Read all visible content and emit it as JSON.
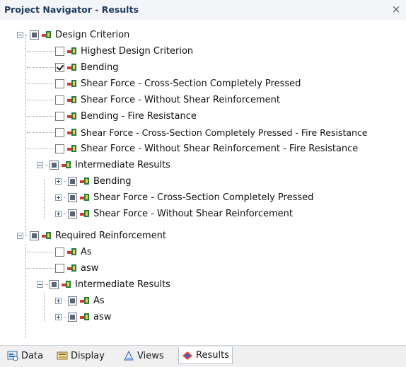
{
  "window": {
    "title": "Project Navigator - Results",
    "close_glyph": "×"
  },
  "tree": [
    {
      "label": "Design Criterion",
      "expander": "minus",
      "check": "partial"
    },
    {
      "label": "Highest Design Criterion",
      "check": "unchecked"
    },
    {
      "label": "Bending",
      "check": "checked"
    },
    {
      "label": "Shear Force - Cross-Section Completely Pressed",
      "check": "unchecked"
    },
    {
      "label": "Shear Force - Without Shear Reinforcement",
      "check": "unchecked"
    },
    {
      "label": "Bending - Fire Resistance",
      "check": "unchecked"
    },
    {
      "label": "Shear Force - Cross-Section Completely Pressed - Fire Resistance",
      "check": "unchecked"
    },
    {
      "label": "Shear Force - Without Shear Reinforcement - Fire Resistance",
      "check": "unchecked"
    },
    {
      "label": "Intermediate Results",
      "expander": "minus",
      "check": "partial"
    },
    {
      "label": "Bending",
      "expander": "plus",
      "check": "partial"
    },
    {
      "label": "Shear Force - Cross-Section Completely Pressed",
      "expander": "plus",
      "check": "partial"
    },
    {
      "label": "Shear Force - Without Shear Reinforcement",
      "expander": "plus",
      "check": "partial"
    },
    {
      "label": "Required Reinforcement",
      "expander": "minus",
      "check": "partial"
    },
    {
      "label": "As",
      "check": "unchecked"
    },
    {
      "label": "asw",
      "check": "unchecked"
    },
    {
      "label": "Intermediate Results",
      "expander": "minus",
      "check": "partial"
    },
    {
      "label": "As",
      "expander": "plus",
      "check": "partial"
    },
    {
      "label": "asw",
      "expander": "plus",
      "check": "partial"
    }
  ],
  "tabs": [
    {
      "label": "Data",
      "icon": "data-icon"
    },
    {
      "label": "Display",
      "icon": "display-icon"
    },
    {
      "label": "Views",
      "icon": "views-icon"
    },
    {
      "label": "Results",
      "icon": "results-icon",
      "active": true
    }
  ]
}
